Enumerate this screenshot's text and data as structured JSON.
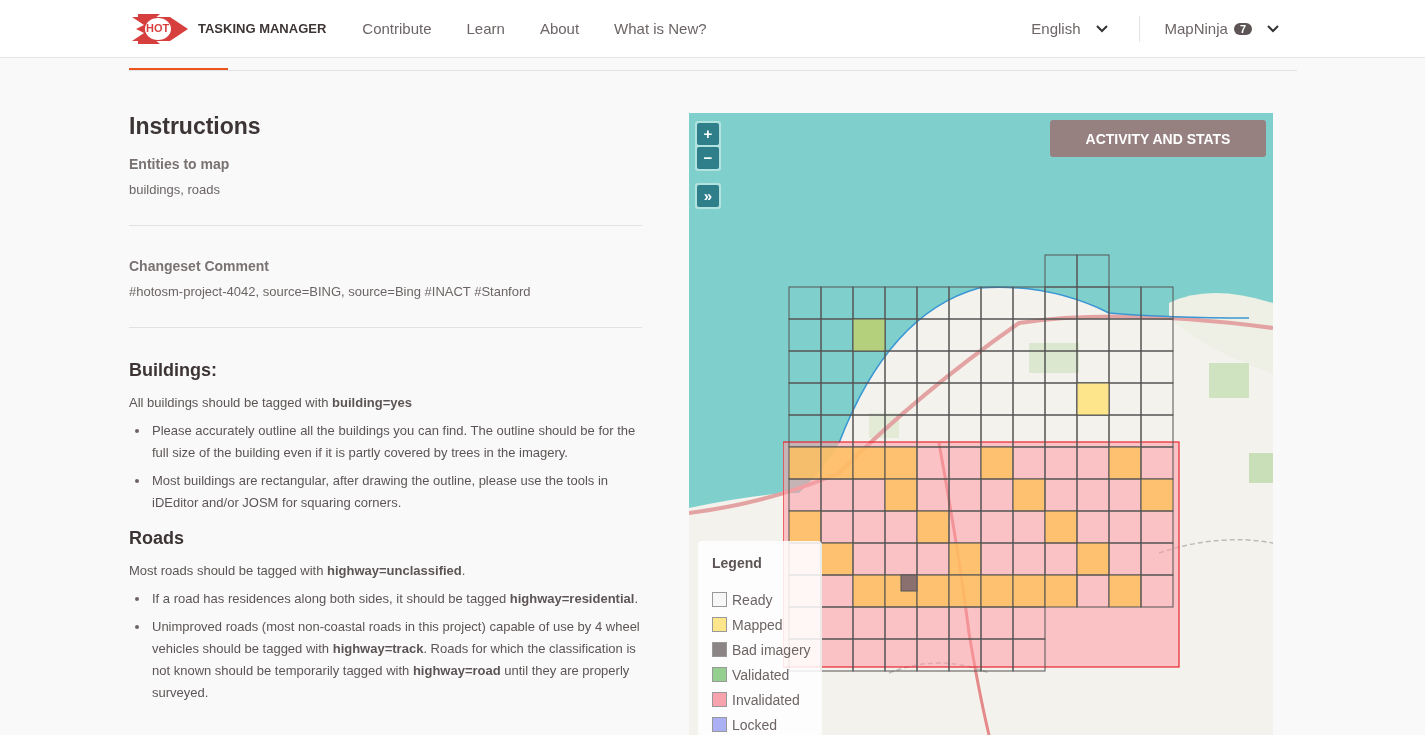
{
  "header": {
    "logo_text": "HOT",
    "brand": "TASKING MANAGER",
    "nav": [
      {
        "label": "Contribute"
      },
      {
        "label": "Learn"
      },
      {
        "label": "About"
      },
      {
        "label": "What is New?"
      }
    ],
    "language": "English",
    "user": {
      "name": "MapNinja",
      "badge": "7"
    }
  },
  "instructions": {
    "title": "Instructions",
    "fields": [
      {
        "label": "Entities to map",
        "value": "buildings, roads"
      },
      {
        "label": "Changeset Comment",
        "value": "#hotosm-project-4042, source=BING, source=Bing #INACT #Stanford"
      }
    ],
    "sections": [
      {
        "heading": "Buildings:",
        "intro": "All buildings should be tagged with **building=yes**",
        "bullets": [
          "Please accurately outline all the buildings you can find. The outline should be for the full size of the building even if it is partly covered by trees in the imagery.",
          "Most buildings are rectangular, after drawing the outline, please use the tools in iDEditor and/or JOSM for squaring corners."
        ]
      },
      {
        "heading": "Roads",
        "intro": "Most roads should be tagged with **highway=unclassified**.",
        "bullets": [
          "If a road has residences along both sides, it should be tagged **highway=residential**.",
          "Unimproved roads (most non-coastal roads in this project) capable of use by 4 wheel vehicles should be tagged with **highway=track**. Roads for which the classification is not known should be temporarily tagged with **highway=road** until they are properly surveyed."
        ]
      }
    ]
  },
  "map": {
    "zoom_in": "+",
    "zoom_out": "−",
    "expand": "»",
    "activity_button": "ACTIVITY AND STATS",
    "legend": {
      "title": "Legend",
      "items": [
        {
          "label": "Ready",
          "color": "#f7f7f7"
        },
        {
          "label": "Mapped",
          "color": "#fde58c"
        },
        {
          "label": "Bad imagery",
          "color": "#8b8585"
        },
        {
          "label": "Validated",
          "color": "#94cf8f"
        },
        {
          "label": "Invalidated",
          "color": "#f7a3ad"
        },
        {
          "label": "Locked",
          "color": "#abb0f5"
        }
      ]
    }
  }
}
